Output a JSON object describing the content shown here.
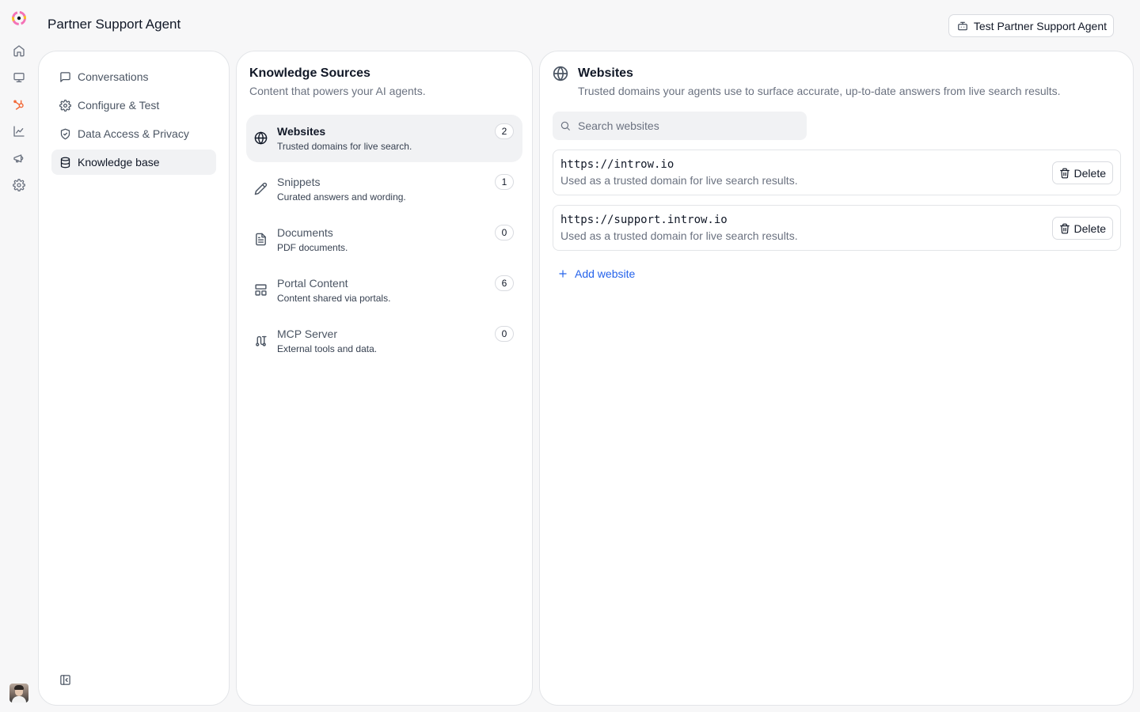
{
  "app": {
    "title": "Partner Support Agent"
  },
  "header": {
    "test_button_label": "Test Partner Support Agent",
    "test_button_icon": "bot-icon"
  },
  "rail": {
    "logo": "app-logo",
    "icons": [
      "home-icon",
      "monitor-icon",
      "hubspot-icon",
      "chart-icon",
      "megaphone-icon",
      "settings-icon"
    ],
    "accent_color": "#f26b3a"
  },
  "nav": {
    "items": [
      {
        "label": "Conversations",
        "icon": "message-square-icon",
        "active": false
      },
      {
        "label": "Configure & Test",
        "icon": "gear-icon",
        "active": false
      },
      {
        "label": "Data Access & Privacy",
        "icon": "shield-check-icon",
        "active": false
      },
      {
        "label": "Knowledge base",
        "icon": "database-icon",
        "active": true
      }
    ],
    "collapse_icon": "panel-collapse-icon"
  },
  "knowledge_sources": {
    "title": "Knowledge Sources",
    "subtitle": "Content that powers your AI agents.",
    "items": [
      {
        "name": "Websites",
        "description": "Trusted domains for live search.",
        "count": "2",
        "icon": "globe-icon",
        "active": true
      },
      {
        "name": "Snippets",
        "description": "Curated answers and wording.",
        "count": "1",
        "icon": "pencil-icon",
        "active": false
      },
      {
        "name": "Documents",
        "description": "PDF documents.",
        "count": "0",
        "icon": "file-text-icon",
        "active": false
      },
      {
        "name": "Portal Content",
        "description": "Content shared via portals.",
        "count": "6",
        "icon": "layout-icon",
        "active": false
      },
      {
        "name": "MCP Server",
        "description": "External tools and data.",
        "count": "0",
        "icon": "plug-icon",
        "active": false
      }
    ]
  },
  "websites": {
    "title": "Websites",
    "subtitle": "Trusted domains your agents use to surface accurate, up-to-date answers from live search results.",
    "search_placeholder": "Search websites",
    "sites": [
      {
        "url": "https://introw.io",
        "description": "Used as a trusted domain for live search results.",
        "delete_label": "Delete"
      },
      {
        "url": "https://support.introw.io",
        "description": "Used as a trusted domain for live search results.",
        "delete_label": "Delete"
      }
    ],
    "add_label": "Add website",
    "link_color": "#2563eb"
  }
}
